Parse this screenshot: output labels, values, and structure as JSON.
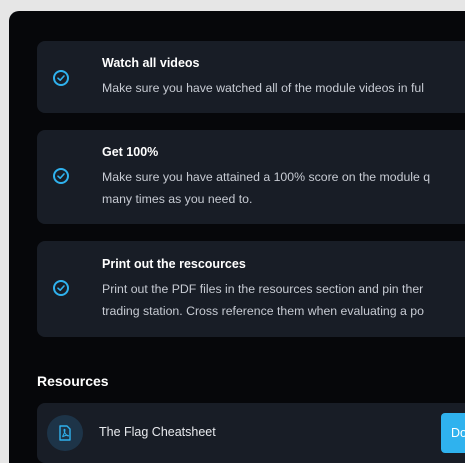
{
  "checklist": [
    {
      "title": "Watch all videos",
      "lines": [
        "Make sure you have watched all of the module videos in ful"
      ]
    },
    {
      "title": "Get 100%",
      "lines": [
        "Make sure you have attained a 100% score on the module q",
        "many times as you need to."
      ]
    },
    {
      "title": "Print out the rescources",
      "lines": [
        "Print out the PDF files in the resources section and pin ther",
        "trading station. Cross reference them when evaluating a po"
      ]
    }
  ],
  "resources": {
    "title": "Resources",
    "items": [
      {
        "label": "The Flag Cheatsheet",
        "button": "Do"
      }
    ]
  },
  "colors": {
    "accent": "#2fb2ee",
    "card": "#181d26",
    "background": "#06070a"
  },
  "icons": {
    "check": "check-circle-icon",
    "pdf": "pdf-file-icon"
  }
}
